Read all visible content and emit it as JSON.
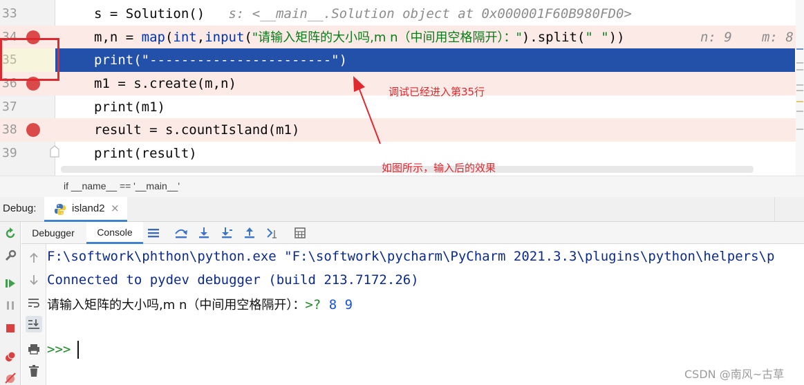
{
  "editor": {
    "lines": [
      {
        "num": "33",
        "breakpoint": false
      },
      {
        "num": "34",
        "breakpoint": true
      },
      {
        "num": "35",
        "breakpoint": false
      },
      {
        "num": "36",
        "breakpoint": true
      },
      {
        "num": "37",
        "breakpoint": false
      },
      {
        "num": "38",
        "breakpoint": true
      },
      {
        "num": "39",
        "breakpoint": false
      }
    ],
    "code": {
      "l33": "s = Solution()",
      "l33_inline": "s: <__main__.Solution object at 0x000001F60B980FD0>",
      "l34_a": "m,n = ",
      "l34_map": "map",
      "l34_b": "(",
      "l34_int": "int",
      "l34_c": ",",
      "l34_input": "input",
      "l34_d": "(",
      "l34_str": "\"请输入矩阵的大小吗,m n（中间用空格隔开）：\"",
      "l34_e": ").split(",
      "l34_str2": "\" \"",
      "l34_f": "))",
      "l34_inline_n": "n: 9",
      "l34_inline_m": "m: 8",
      "l35_print": "print(",
      "l35_str": "\"-----------------------\"",
      "l35_close": ")",
      "l36": "m1 = s.create(m,n)",
      "l37_print": "print",
      "l37_rest": "(m1)",
      "l38": "result = s.countIsland(m1)",
      "l39_print": "print",
      "l39_rest": "(result)"
    },
    "breadcrumb": "if __name__ == '__main__'"
  },
  "annotations": {
    "current_line_note": "调试已经进入第35行",
    "result_note": "如图所示，输入后的效果",
    "color": "#e0282f"
  },
  "debug": {
    "label": "Debug:",
    "session_tab": "island2",
    "close_glyph": "×",
    "sub_tabs": [
      "Debugger",
      "Console"
    ],
    "active_sub_tab": "Console"
  },
  "console": {
    "line1": "F:\\softwork\\phthon\\python.exe \"F:\\softwork\\pycharm\\PyCharm 2021.3.3\\plugins\\python\\helpers\\p",
    "line2": "Connected to pydev debugger (build 213.7172.26)",
    "line3_prompt": "请输入矩阵的大小吗,m n（中间用空格隔开）：",
    "line3_marker": ">?",
    "line3_input": "8 9",
    "prompt": ">>>"
  },
  "watermark": "CSDN @南风~古草",
  "colors": {
    "current_line": "#2350a9",
    "breakpoint_line": "#fbeae6",
    "breakpoint_dot": "#db4a4a",
    "keyword": "#0033b3",
    "string": "#067d17",
    "console_blue": "#0b2a8f",
    "console_green": "#1f8a24",
    "tab_underline": "#4083c9"
  }
}
